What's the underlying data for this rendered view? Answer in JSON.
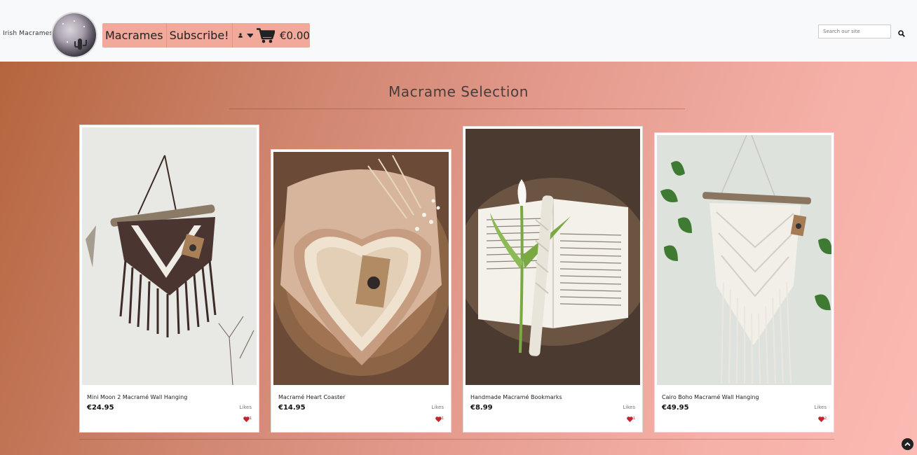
{
  "header": {
    "brand": "Irish Macrames",
    "nav": {
      "macrames_label": "Macrames",
      "subscribe_label": "Subscribe!",
      "cart_total": "€0.00"
    },
    "search": {
      "placeholder": "Search our site"
    }
  },
  "main": {
    "title": "Macrame Selection",
    "products": [
      {
        "name": "Mini Moon 2 Macramé Wall Hanging",
        "price": "€24.95",
        "likes_label": "Likes",
        "like_count": "1"
      },
      {
        "name": "Macramé Heart Coaster",
        "price": "€14.95",
        "likes_label": "Likes",
        "like_count": "1"
      },
      {
        "name": "Handmade Macramé Bookmarks",
        "price": "€8.99",
        "likes_label": "Likes",
        "like_count": "1"
      },
      {
        "name": "Cairo Boho Macramé Wall Hanging",
        "price": "€49.95",
        "likes_label": "Likes",
        "like_count": "2"
      }
    ]
  },
  "icons": {
    "user": "user-icon",
    "caret": "caret-down-icon",
    "cart": "shopping-cart-icon",
    "search": "search-icon",
    "heart": "heart-icon",
    "scroll_top": "chevron-up-circle-icon"
  },
  "colors": {
    "nav_button": "#f0a99a",
    "heart": "#c0262d",
    "gradient_start": "#b5653d",
    "gradient_end": "#fbbab3"
  }
}
